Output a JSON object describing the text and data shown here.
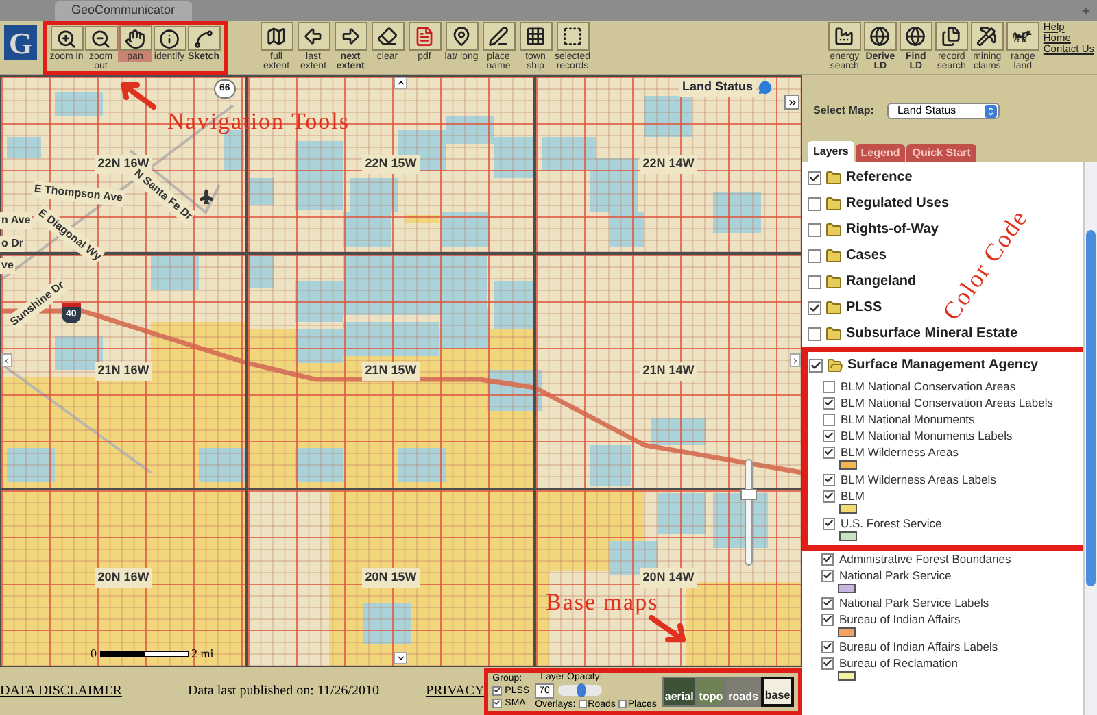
{
  "window": {
    "title": "GeoCommunicator"
  },
  "logo_text": "G",
  "nav_tools": [
    {
      "label": "zoom in",
      "selected": false,
      "emphasized": false
    },
    {
      "label": "zoom out",
      "selected": false,
      "emphasized": false
    },
    {
      "label": "pan",
      "selected": true,
      "emphasized": false
    },
    {
      "label": "identify",
      "selected": false,
      "emphasized": false
    },
    {
      "label": "Sketch",
      "selected": false,
      "emphasized": true
    }
  ],
  "tools": [
    {
      "label": "full extent",
      "emphasized": false
    },
    {
      "label": "last extent",
      "emphasized": false
    },
    {
      "label": "next extent",
      "emphasized": true
    },
    {
      "label": "clear",
      "emphasized": false
    },
    {
      "label": "pdf",
      "emphasized": false
    },
    {
      "label": "lat/ long",
      "emphasized": false
    },
    {
      "label": "place name",
      "emphasized": false
    },
    {
      "label": "town ship",
      "emphasized": false
    },
    {
      "label": "selected records",
      "emphasized": false
    }
  ],
  "search_tools": [
    {
      "label": "energy search",
      "emphasized": false
    },
    {
      "label": "Derive LD",
      "emphasized": true
    },
    {
      "label": "Find LD",
      "emphasized": true
    },
    {
      "label": "record search",
      "emphasized": false
    },
    {
      "label": "mining claims",
      "emphasized": false
    },
    {
      "label": "range land",
      "emphasized": false
    }
  ],
  "links": [
    "Help",
    "Home",
    "Contact Us"
  ],
  "map": {
    "title": "Land Status",
    "townships": [
      "22N 16W",
      "22N 15W",
      "22N 14W",
      "21N 16W",
      "21N 15W",
      "21N 14W",
      "20N 16W",
      "20N 15W",
      "20N 14W"
    ],
    "streets": [
      "E Thompson Ave",
      "N Santa Fe Dr",
      "E Diagonal Wy",
      "Sunshine Dr",
      "n Ave",
      "o Dr",
      "ve"
    ],
    "route_shields": [
      "66",
      "40"
    ],
    "zoom_slider": {
      "level": 0.7
    },
    "scale_bar": {
      "start": "0",
      "end": "2 mi"
    }
  },
  "panel": {
    "select_label": "Select Map:",
    "select_value": "Land Status",
    "tabs": [
      {
        "label": "Layers",
        "selected": true
      },
      {
        "label": "Legend",
        "selected": false
      },
      {
        "label": "Quick Start",
        "selected": false
      }
    ],
    "layers": [
      {
        "name": "Reference",
        "checked": true,
        "expanded": false
      },
      {
        "name": "Regulated Uses",
        "checked": false,
        "expanded": false
      },
      {
        "name": "Rights-of-Way",
        "checked": false,
        "expanded": false
      },
      {
        "name": "Cases",
        "checked": false,
        "expanded": false
      },
      {
        "name": "Rangeland",
        "checked": false,
        "expanded": false
      },
      {
        "name": "PLSS",
        "checked": true,
        "expanded": false
      },
      {
        "name": "Subsurface Mineral Estate",
        "checked": false,
        "expanded": false
      },
      {
        "name": "Surface Management Agency",
        "checked": true,
        "expanded": true,
        "children": [
          {
            "name": "BLM National Conservation Areas",
            "checked": false
          },
          {
            "name": "BLM National Conservation Areas Labels",
            "checked": true
          },
          {
            "name": "BLM National Monuments",
            "checked": false
          },
          {
            "name": "BLM National Monuments Labels",
            "checked": true
          },
          {
            "name": "BLM Wilderness Areas",
            "checked": true,
            "color": "#f2b64e"
          },
          {
            "name": "BLM Wilderness Areas Labels",
            "checked": true
          },
          {
            "name": "BLM",
            "checked": true,
            "color": "#f4db72"
          },
          {
            "name": "U.S. Forest Service",
            "checked": true,
            "color": "#c6e5bf"
          },
          {
            "name": "Administrative Forest Boundaries",
            "checked": true
          },
          {
            "name": "National Park Service",
            "checked": true,
            "color": "#c9b6df"
          },
          {
            "name": "National Park Service Labels",
            "checked": true
          },
          {
            "name": "Bureau of Indian Affairs",
            "checked": true,
            "color": "#f3a063"
          },
          {
            "name": "Bureau of Indian Affairs Labels",
            "checked": true
          },
          {
            "name": "Bureau of Reclamation",
            "checked": true,
            "color": "#f4f1a0"
          }
        ]
      }
    ]
  },
  "footer": {
    "disclaimer": "DATA DISCLAIMER",
    "published": "Data last published on: 11/26/2010",
    "privacy": "PRIVACY"
  },
  "basemap_control": {
    "group_label": "Group:",
    "groups": [
      {
        "label": "PLSS",
        "checked": true
      },
      {
        "label": "SMA",
        "checked": true
      }
    ],
    "opacity_label": "Layer Opacity:",
    "opacity_value": "70",
    "opacity": {
      "level": 0.55
    },
    "overlays_label": "Overlays:",
    "overlays": [
      {
        "label": "Roads",
        "checked": false
      },
      {
        "label": "Places",
        "checked": false
      }
    ],
    "basemaps": [
      {
        "label": "aerial",
        "selected": false
      },
      {
        "label": "topo",
        "selected": false
      },
      {
        "label": "roads",
        "selected": false
      },
      {
        "label": "base",
        "selected": true
      }
    ]
  },
  "annotations": [
    {
      "text": "Navigation Tools"
    },
    {
      "text": "Color Code"
    },
    {
      "text": "Base maps"
    }
  ]
}
